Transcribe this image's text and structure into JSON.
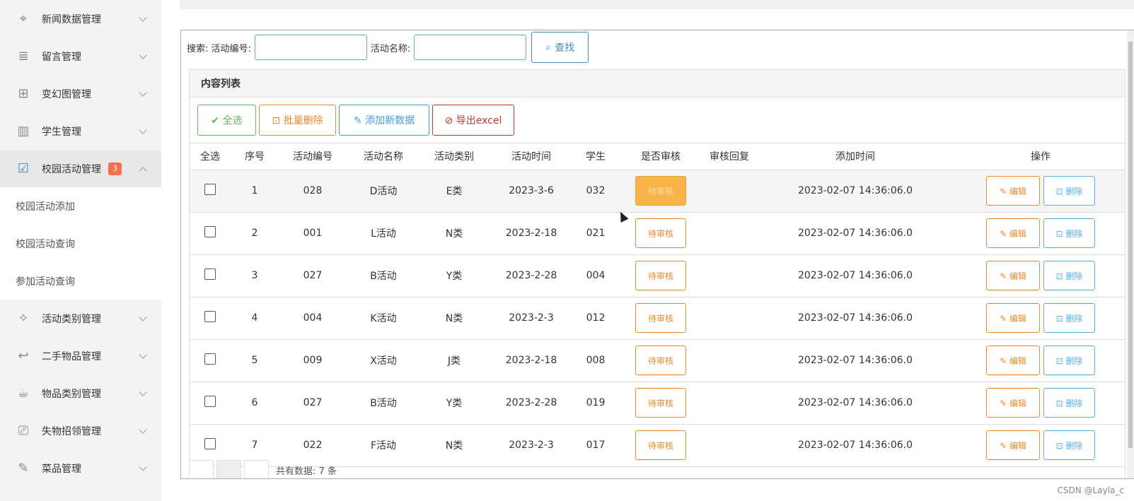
{
  "sidebar": {
    "items": [
      {
        "label": "新闻数据管理",
        "icon": "crosshair-icon",
        "glyph": "⌖"
      },
      {
        "label": "留言管理",
        "icon": "list-icon",
        "glyph": "≣"
      },
      {
        "label": "变幻图管理",
        "icon": "gift-icon",
        "glyph": "⊞"
      },
      {
        "label": "学生管理",
        "icon": "map-icon",
        "glyph": "▥"
      },
      {
        "label": "校园活动管理",
        "icon": "checkbox-icon",
        "glyph": "☑",
        "badge": "3"
      },
      {
        "label": "活动类别管理",
        "icon": "magic-wand-icon",
        "glyph": "✧"
      },
      {
        "label": "二手物品管理",
        "icon": "reply-icon",
        "glyph": "↩"
      },
      {
        "label": "物品类别管理",
        "icon": "coffee-icon",
        "glyph": "☕"
      },
      {
        "label": "失物招领管理",
        "icon": "camera-icon",
        "glyph": "⎚"
      },
      {
        "label": "菜品管理",
        "icon": "pencil-icon",
        "glyph": "✎"
      }
    ],
    "submenu": [
      "校园活动添加",
      "校园活动查询",
      "参加活动查询"
    ]
  },
  "search": {
    "prefix": "搜索: 活动编号:",
    "name_label": "活动名称:",
    "button": "查找",
    "button_icon": "⌕"
  },
  "panel": {
    "title": "内容列表",
    "toolbar": {
      "select_all": "✔ 全选",
      "batch_delete": "⊡ 批量删除",
      "add_new": "✎ 添加新数据",
      "export": "⊘ 导出excel"
    }
  },
  "table": {
    "headers": [
      "全选",
      "序号",
      "活动编号",
      "活动名称",
      "活动类别",
      "活动时间",
      "学生",
      "是否审核",
      "审核回复",
      "添加时间",
      "操作"
    ],
    "rows": [
      {
        "seq": "1",
        "code": "028",
        "name": "D活动",
        "category": "E类",
        "date": "2023-3-6",
        "student": "032",
        "audit": "待审核",
        "reply": "",
        "added": "2023-02-07 14:36:06.0"
      },
      {
        "seq": "2",
        "code": "001",
        "name": "L活动",
        "category": "N类",
        "date": "2023-2-18",
        "student": "021",
        "audit": "待审核",
        "reply": "",
        "added": "2023-02-07 14:36:06.0"
      },
      {
        "seq": "3",
        "code": "027",
        "name": "B活动",
        "category": "Y类",
        "date": "2023-2-28",
        "student": "004",
        "audit": "待审核",
        "reply": "",
        "added": "2023-02-07 14:36:06.0"
      },
      {
        "seq": "4",
        "code": "004",
        "name": "K活动",
        "category": "N类",
        "date": "2023-2-3",
        "student": "012",
        "audit": "待审核",
        "reply": "",
        "added": "2023-02-07 14:36:06.0"
      },
      {
        "seq": "5",
        "code": "009",
        "name": "X活动",
        "category": "J类",
        "date": "2023-2-18",
        "student": "008",
        "audit": "待审核",
        "reply": "",
        "added": "2023-02-07 14:36:06.0"
      },
      {
        "seq": "6",
        "code": "027",
        "name": "B活动",
        "category": "Y类",
        "date": "2023-2-28",
        "student": "019",
        "audit": "待审核",
        "reply": "",
        "added": "2023-02-07 14:36:06.0"
      },
      {
        "seq": "7",
        "code": "022",
        "name": "F活动",
        "category": "N类",
        "date": "2023-2-3",
        "student": "017",
        "audit": "待审核",
        "reply": "",
        "added": "2023-02-07 14:36:06.0"
      }
    ],
    "edit_label": "✎ 编辑",
    "delete_label": "⊡ 删除"
  },
  "pager": {
    "text": "共有数据: 7 条"
  },
  "watermark": "CSDN @Layla_c"
}
